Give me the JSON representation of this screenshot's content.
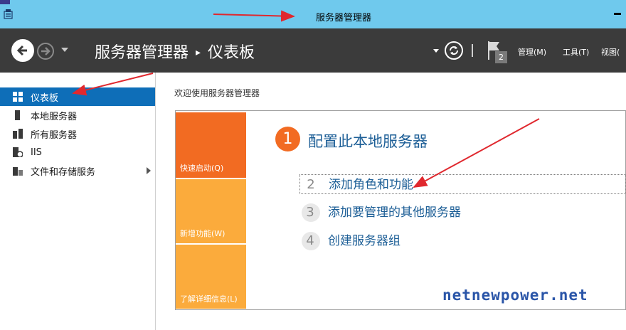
{
  "window": {
    "title": "服务器管理器"
  },
  "header": {
    "breadcrumb_root": "服务器管理器",
    "breadcrumb_sep": "▸",
    "breadcrumb_current": "仪表板",
    "notification_count": "2",
    "menu": [
      {
        "label": "管理(M)"
      },
      {
        "label": "工具(T)"
      },
      {
        "label": "视图("
      }
    ]
  },
  "sidebar": {
    "items": [
      {
        "label": "仪表板",
        "icon": "dashboard-grid-icon",
        "active": true
      },
      {
        "label": "本地服务器",
        "icon": "server-icon"
      },
      {
        "label": "所有服务器",
        "icon": "servers-icon"
      },
      {
        "label": "IIS",
        "icon": "iis-icon"
      },
      {
        "label": "文件和存储服务",
        "icon": "file-storage-icon",
        "has_submenu": true
      }
    ]
  },
  "main": {
    "welcome_title": "欢迎使用服务器管理器",
    "tiles": [
      {
        "label": "快速启动(Q)",
        "color": "#f26b22"
      },
      {
        "label": "新增功能(W)",
        "color": "#fbab3c"
      },
      {
        "label": "了解详细信息(L)",
        "color": "#fbab3c"
      }
    ],
    "step1": {
      "number": "1",
      "label": "配置此本地服务器"
    },
    "tasks": [
      {
        "number": "2",
        "label": "添加角色和功能"
      },
      {
        "number": "3",
        "label": "添加要管理的其他服务器"
      },
      {
        "number": "4",
        "label": "创建服务器组"
      }
    ]
  },
  "watermark": "netnewpower.net",
  "colors": {
    "titlebar": "#6fc9ed",
    "header": "#3b3b3b",
    "active": "#0e6eb8",
    "accent_orange": "#f26b22",
    "tile_yellow": "#fbab3c",
    "link_blue": "#1c5e96",
    "annotation_red": "#e0282e"
  }
}
